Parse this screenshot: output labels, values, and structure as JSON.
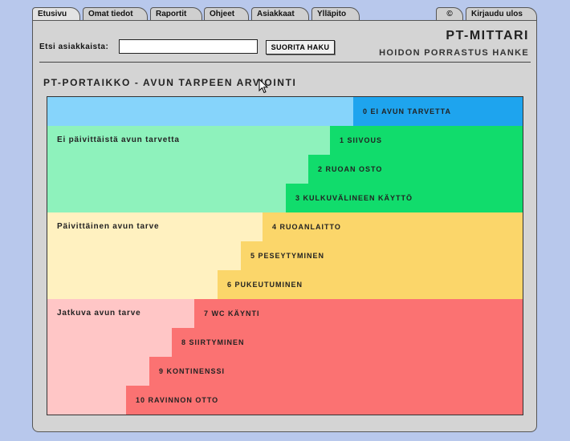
{
  "tabs": [
    {
      "label": "Etusivu",
      "active": true
    },
    {
      "label": "Omat tiedot"
    },
    {
      "label": "Raportit"
    },
    {
      "label": "Ohjeet"
    },
    {
      "label": "Asiakkaat"
    },
    {
      "label": "Ylläpito"
    },
    {
      "label": "©"
    },
    {
      "label": "Kirjaudu ulos"
    }
  ],
  "search": {
    "label": "Etsi asiakkaista:",
    "value": "",
    "button_label": "SUORITA HAKU"
  },
  "brand": {
    "title": "PT-MITTARI",
    "subtitle": "HOIDON PORRASTUS HANKE"
  },
  "page_title": "PT-PORTAIKKO - AVUN TARPEEN ARVIOINTI",
  "ladder": {
    "categories": {
      "none": {
        "color_light": "#86d4fb",
        "color_dark": "#1ea4ee"
      },
      "daily_not": {
        "label": "Ei päivittäistä avun tarvetta",
        "color_light": "#8ef2bc",
        "color_dark": "#11dc6c"
      },
      "daily": {
        "label": "Päivittäinen avun tarve",
        "color_light": "#fff1c0",
        "color_dark": "#fbd66a"
      },
      "continuous": {
        "label": "Jatkuva avun tarve",
        "color_light": "#ffc6c6",
        "color_dark": "#fb7272"
      }
    },
    "steps": [
      {
        "label": "0 EI AVUN TARVETTA",
        "category": "none"
      },
      {
        "label": "1 SIIVOUS",
        "category": "daily_not"
      },
      {
        "label": "2 RUOAN OSTO",
        "category": "daily_not"
      },
      {
        "label": "3 KULKUVÄLINEEN KÄYTTÖ",
        "category": "daily_not"
      },
      {
        "label": "4 RUOANLAITTO",
        "category": "daily"
      },
      {
        "label": "5 PESEYTYMINEN",
        "category": "daily"
      },
      {
        "label": "6 PUKEUTUMINEN",
        "category": "daily"
      },
      {
        "label": "7 WC KÄYNTI",
        "category": "continuous"
      },
      {
        "label": "8 SIIRTYMINEN",
        "category": "continuous"
      },
      {
        "label": "9 KONTINENSSI",
        "category": "continuous"
      },
      {
        "label": "10 RAVINNON OTTO",
        "category": "continuous"
      }
    ]
  }
}
